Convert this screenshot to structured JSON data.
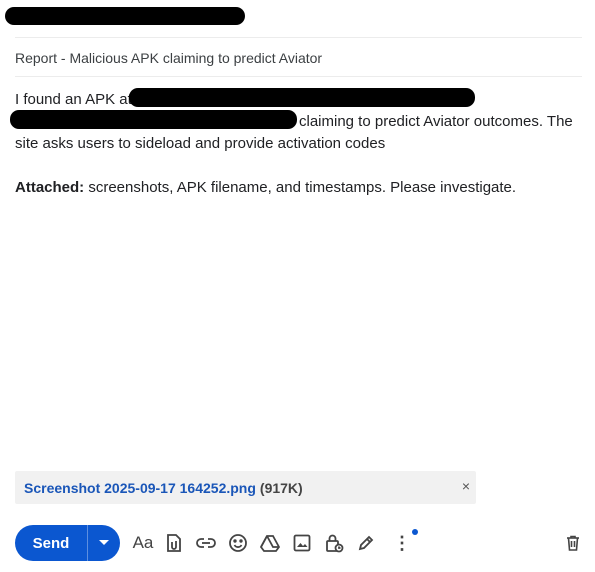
{
  "recipient": {
    "redacted": true
  },
  "subject": "Report - Malicious APK claiming to predict Aviator",
  "body": {
    "line1_prefix": "I found an APK at",
    "line2_suffix": "claiming to predict Aviator outcomes. The",
    "line3": "site asks users to sideload and provide activation codes",
    "attached_label": "Attached:",
    "attached_text": " screenshots, APK filename, and timestamps. Please investigate."
  },
  "attachment": {
    "filename": "Screenshot 2025-09-17 164252.png",
    "size": "(917K)",
    "close_glyph": "×"
  },
  "toolbar": {
    "send_label": "Send",
    "format_label": "Aa",
    "more_glyph": "⋮",
    "icons": [
      "format-text-icon",
      "attach-file-icon",
      "insert-link-icon",
      "emoji-icon",
      "google-drive-icon",
      "insert-photo-icon",
      "confidential-mode-icon",
      "signature-icon",
      "more-options-icon",
      "discard-draft-icon"
    ]
  },
  "colors": {
    "primary": "#0b57d0",
    "link": "#1a56b8",
    "notification_dot": "#0b57d0"
  }
}
